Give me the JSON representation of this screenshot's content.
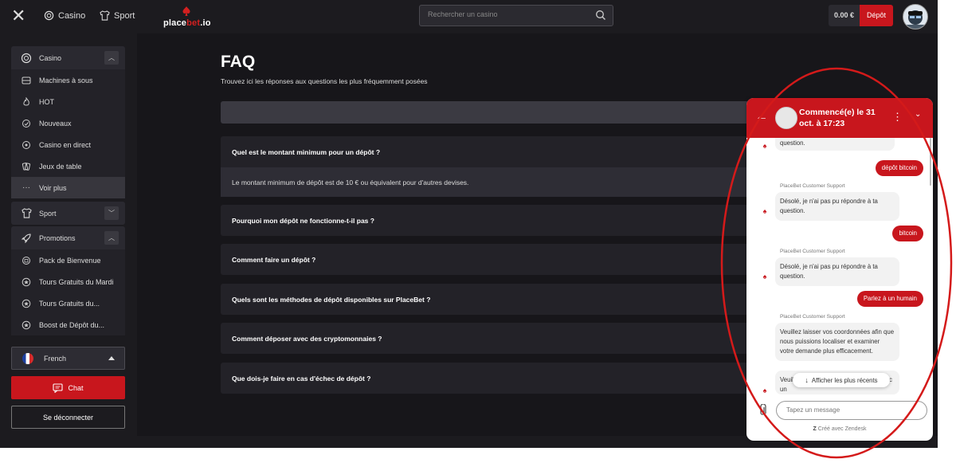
{
  "topbar": {
    "nav": [
      {
        "label": "Casino",
        "icon": "casino-chip-icon"
      },
      {
        "label": "Sport",
        "icon": "jersey-icon"
      }
    ],
    "logo_text_a": "place",
    "logo_text_b": "bet",
    "logo_text_c": ".io",
    "search_placeholder": "Rechercher un casino",
    "balance": "0.00 €",
    "deposit_label": "Dépôt"
  },
  "sidebar": {
    "casino": {
      "label": "Casino",
      "items": [
        {
          "label": "Machines à sous",
          "icon": "slot-machine-icon"
        },
        {
          "label": "HOT",
          "icon": "flame-icon"
        },
        {
          "label": "Nouveaux",
          "icon": "new-badge-icon"
        },
        {
          "label": "Casino en direct",
          "icon": "live-casino-icon"
        },
        {
          "label": "Jeux de table",
          "icon": "cards-icon"
        }
      ],
      "more_label": "Voir plus"
    },
    "sport_label": "Sport",
    "promotions": {
      "label": "Promotions",
      "items": [
        {
          "label": "Pack de Bienvenue",
          "icon": "gift-icon"
        },
        {
          "label": "Tours Gratuits du Mardi",
          "icon": "star-icon"
        },
        {
          "label": "Tours Gratuits du...",
          "icon": "star-icon"
        },
        {
          "label": "Boost de Dépôt du...",
          "icon": "star-icon"
        }
      ]
    },
    "language": "French",
    "chat_label": "Chat",
    "logout_label": "Se déconnecter"
  },
  "faq": {
    "title": "FAQ",
    "subtitle": "Trouvez ici les réponses aux questions les plus fréquemment posées",
    "questions": [
      "Quel est le montant minimum pour un dépôt ?",
      "Pourquoi mon dépôt ne fonctionne-t-il pas ?",
      "Comment faire un dépôt ?",
      "Quels sont les méthodes de dépôt disponibles sur PlaceBet ?",
      "Comment déposer avec des cryptomonnaies ?",
      "Que dois-je faire en cas d'échec de dépôt ?"
    ],
    "open_answer": "Le montant minimum de dépôt est de 10 € ou équivalent pour d'autres devises."
  },
  "chat_widget": {
    "header_title": "Commencé(e) le 31 oct. à 17:23",
    "agent_name": "PlaceBet Customer Support",
    "messages": [
      {
        "from": "agent",
        "text": "question."
      },
      {
        "from": "user",
        "text": "dépôt bitcoin"
      },
      {
        "from": "agent",
        "text": "Désolé, je n'ai pas pu répondre à ta question."
      },
      {
        "from": "user",
        "text": "bitcoin"
      },
      {
        "from": "agent",
        "text": "Désolé, je n'ai pas pu répondre à ta question."
      },
      {
        "from": "user",
        "text": "Parlez à un humain"
      },
      {
        "from": "agent",
        "text": "Veuillez laisser vos coordonnées afin que nous puissions localiser et examiner votre demande plus efficacement."
      },
      {
        "from": "agent",
        "text": "Veuillez ... vous mettons en contact avec un"
      }
    ],
    "show_recent_label": "Afficher les plus récents",
    "input_placeholder": "Tapez un message",
    "powered_by": "Créé avec Zendesk"
  },
  "colors": {
    "accent": "#c8161d",
    "background": "#1c1b1f",
    "annotation": "#d41a1a"
  }
}
